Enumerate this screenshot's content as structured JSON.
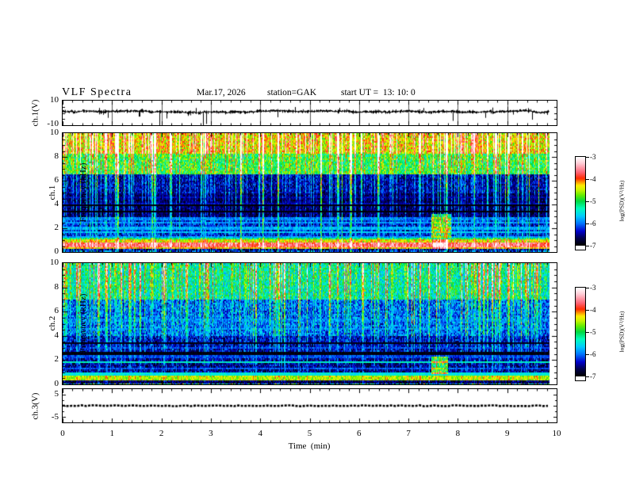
{
  "title": {
    "main": "VLF Spectra",
    "date": "Mar.17, 2026",
    "station": "station=GAK",
    "start_ut": "start UT =  13: 10: 0"
  },
  "x_axis": {
    "label": "Time  (min)",
    "tick_labels": [
      "0",
      "1",
      "2",
      "3",
      "4",
      "5",
      "6",
      "7",
      "8",
      "9",
      "10"
    ],
    "min": 0,
    "max": 10
  },
  "colorbar": {
    "label": "log(PSD)(V²/Hz)",
    "tick_labels": [
      "-3",
      "-4",
      "-5",
      "-6",
      "-7"
    ],
    "min": -7,
    "max": -3
  },
  "panels": [
    {
      "id": "ch1v",
      "ylabel": "ch.1(V)",
      "ytick_labels": [
        "10",
        "-10"
      ]
    },
    {
      "id": "spec1",
      "ylabel_channel": "ch.1",
      "ylabel_axis": "Frequency (kHz)",
      "ytick_labels": [
        "10",
        "8",
        "6",
        "4",
        "2",
        "0"
      ]
    },
    {
      "id": "spec2",
      "ylabel_channel": "ch.2",
      "ylabel_axis": "Frequency (kHz)",
      "ytick_labels": [
        "10",
        "8",
        "6",
        "4",
        "2",
        "0"
      ]
    },
    {
      "id": "ch3v",
      "ylabel": "ch.3(V)",
      "ytick_labels": [
        "5",
        "-5"
      ]
    }
  ],
  "colors": {
    "background": "#ffffff",
    "frame": "#000000",
    "trace": "#000000",
    "gridline": "#555555"
  },
  "colormap": {
    "min": -7,
    "max": -3,
    "stops": [
      [
        0.0,
        "#000000"
      ],
      [
        0.08,
        "#00004d"
      ],
      [
        0.16,
        "#0000cc"
      ],
      [
        0.25,
        "#0077ff"
      ],
      [
        0.33,
        "#00ccff"
      ],
      [
        0.42,
        "#00ffbb"
      ],
      [
        0.5,
        "#00d944"
      ],
      [
        0.57,
        "#66ee00"
      ],
      [
        0.63,
        "#ccf500"
      ],
      [
        0.68,
        "#ffee00"
      ],
      [
        0.72,
        "#ff9100"
      ],
      [
        0.76,
        "#ff2a00"
      ],
      [
        0.83,
        "#ff6677"
      ],
      [
        0.93,
        "#ffccd5"
      ],
      [
        1.0,
        "#ffffff"
      ]
    ]
  },
  "chart_data": [
    {
      "id": "ch1_timeseries",
      "type": "line",
      "ylabel": "ch.1(V)",
      "ylim": [
        -10,
        10
      ],
      "xlim_min": [
        0,
        10
      ],
      "data_end_min": 9.85,
      "baseline": 1.0,
      "noise_amp": 0.9,
      "spikes": [
        {
          "t": 0.92,
          "v": -4
        },
        {
          "t": 1.55,
          "v": -3
        },
        {
          "t": 1.96,
          "v": -10
        },
        {
          "t": 2.1,
          "v": -4.5
        },
        {
          "t": 2.7,
          "v": 4
        },
        {
          "t": 2.84,
          "v": -10
        },
        {
          "t": 2.91,
          "v": -9
        },
        {
          "t": 4.35,
          "v": -3.5
        },
        {
          "t": 4.7,
          "v": 4.8
        },
        {
          "t": 5.6,
          "v": 4.2
        },
        {
          "t": 6.0,
          "v": -8
        },
        {
          "t": 7.3,
          "v": 4
        },
        {
          "t": 7.9,
          "v": -6.5
        },
        {
          "t": 8.55,
          "v": -4
        },
        {
          "t": 9.0,
          "v": 5
        },
        {
          "t": 9.5,
          "v": -5.5
        }
      ],
      "seed": 5
    },
    {
      "id": "ch1_spectrogram",
      "type": "heatmap",
      "ylabel": "ch.1 Frequency (kHz)",
      "x_range_min": [
        0,
        9.85
      ],
      "y_range_khz": [
        0,
        10
      ],
      "clim_log_psd": [
        -7,
        -3
      ],
      "bands": [
        {
          "f": [
            0,
            0.12
          ],
          "psd": -6.3,
          "jitter": 0.7
        },
        {
          "f": [
            0.12,
            0.3
          ],
          "psd": -6.6,
          "jitter": 0.6
        },
        {
          "f": [
            0.3,
            0.45
          ],
          "psd": -4.35,
          "jitter": 0.35
        },
        {
          "f": [
            0.45,
            0.8
          ],
          "psd": -3.75,
          "jitter": 0.35
        },
        {
          "f": [
            0.8,
            1.0
          ],
          "psd": -4.5,
          "jitter": 0.4
        },
        {
          "f": [
            1.0,
            1.15
          ],
          "psd": -5.3,
          "jitter": 0.4
        },
        {
          "f": [
            1.15,
            3.0
          ],
          "psd": -6.35,
          "jitter": 0.45
        },
        {
          "f": [
            3.0,
            5.0
          ],
          "psd": -6.75,
          "jitter": 0.3
        },
        {
          "f": [
            5.0,
            6.5
          ],
          "psd": -6.55,
          "jitter": 0.4
        },
        {
          "f": [
            6.5,
            8.3
          ],
          "psd": -5.1,
          "jitter": 0.55
        },
        {
          "f": [
            8.3,
            10.01
          ],
          "psd": -4.5,
          "jitter": 0.5
        }
      ],
      "hlines": [
        {
          "f": 1.3,
          "psd": -5.9
        },
        {
          "f": 1.65,
          "psd": -5.7
        },
        {
          "f": 2.0,
          "psd": -5.8
        },
        {
          "f": 2.45,
          "psd": -5.9
        },
        {
          "f": 2.8,
          "psd": -6.0
        },
        {
          "f": 4.1,
          "psd": -6.45
        },
        {
          "f": 4.55,
          "psd": -6.5
        }
      ],
      "dark_hlines": [
        {
          "f": 3.4,
          "psd": -7
        },
        {
          "f": 3.9,
          "psd": -7
        }
      ],
      "streaks": {
        "tail": 6,
        "max_boost": 3.2,
        "floor": 0.3,
        "top_boost": 0.5,
        "top_f": 8.3,
        "persist": 0.18
      },
      "blobs": [
        {
          "t": [
            7.45,
            7.85
          ],
          "f": [
            1.2,
            3.2
          ],
          "boost": 1.3
        },
        {
          "t": [
            7.5,
            7.8
          ],
          "f": [
            0.3,
            1.0
          ],
          "boost": 0.6
        }
      ],
      "seed": 7
    },
    {
      "id": "ch2_spectrogram",
      "type": "heatmap",
      "ylabel": "ch.2 Frequency (kHz)",
      "x_range_min": [
        0,
        9.85
      ],
      "y_range_khz": [
        0,
        10
      ],
      "clim_log_psd": [
        -7,
        -3
      ],
      "bands": [
        {
          "f": [
            0,
            0.12
          ],
          "psd": -5.6,
          "jitter": 1.4
        },
        {
          "f": [
            0.12,
            0.3
          ],
          "psd": -6.75,
          "jitter": 0.35
        },
        {
          "f": [
            0.3,
            0.75
          ],
          "psd": -4.6,
          "jitter": 0.35
        },
        {
          "f": [
            0.75,
            1.0
          ],
          "psd": -6.3,
          "jitter": 0.45
        },
        {
          "f": [
            1.0,
            2.1
          ],
          "psd": -6.6,
          "jitter": 0.45
        },
        {
          "f": [
            2.1,
            4.0
          ],
          "psd": -6.5,
          "jitter": 0.45
        },
        {
          "f": [
            4.0,
            7.0
          ],
          "psd": -6.15,
          "jitter": 0.5
        },
        {
          "f": [
            7.0,
            10.01
          ],
          "psd": -5.45,
          "jitter": 0.55
        }
      ],
      "hlines": [
        {
          "f": 0.85,
          "psd": -5.5
        },
        {
          "f": 1.35,
          "psd": -6.1
        },
        {
          "f": 1.8,
          "psd": -5.4
        },
        {
          "f": 2.3,
          "psd": -6.2
        },
        {
          "f": 3.05,
          "psd": -6.2
        },
        {
          "f": 4.6,
          "psd": -6.0
        },
        {
          "f": 5.3,
          "psd": -6.05
        }
      ],
      "dark_hlines": [
        {
          "f": 2.55,
          "psd": -6.95
        },
        {
          "f": 3.35,
          "psd": -6.9
        }
      ],
      "streaks": {
        "tail": 5,
        "max_boost": 2.5,
        "floor": 0.16,
        "persist": 0.18
      },
      "blobs": [
        {
          "t": [
            7.45,
            7.8
          ],
          "f": [
            0.9,
            2.3
          ],
          "boost": 1.5
        }
      ],
      "seed": 13
    },
    {
      "id": "ch3_timeseries",
      "type": "line",
      "ylabel": "ch.3(V)",
      "ylim": [
        -7.3,
        7.3
      ],
      "xlim_min": [
        0,
        10
      ],
      "data_end_min": 9.85,
      "baseline": 0,
      "noise_amp": 0.15,
      "flat": true,
      "line_width": 2.6,
      "spikes": [],
      "seed": 99
    }
  ]
}
